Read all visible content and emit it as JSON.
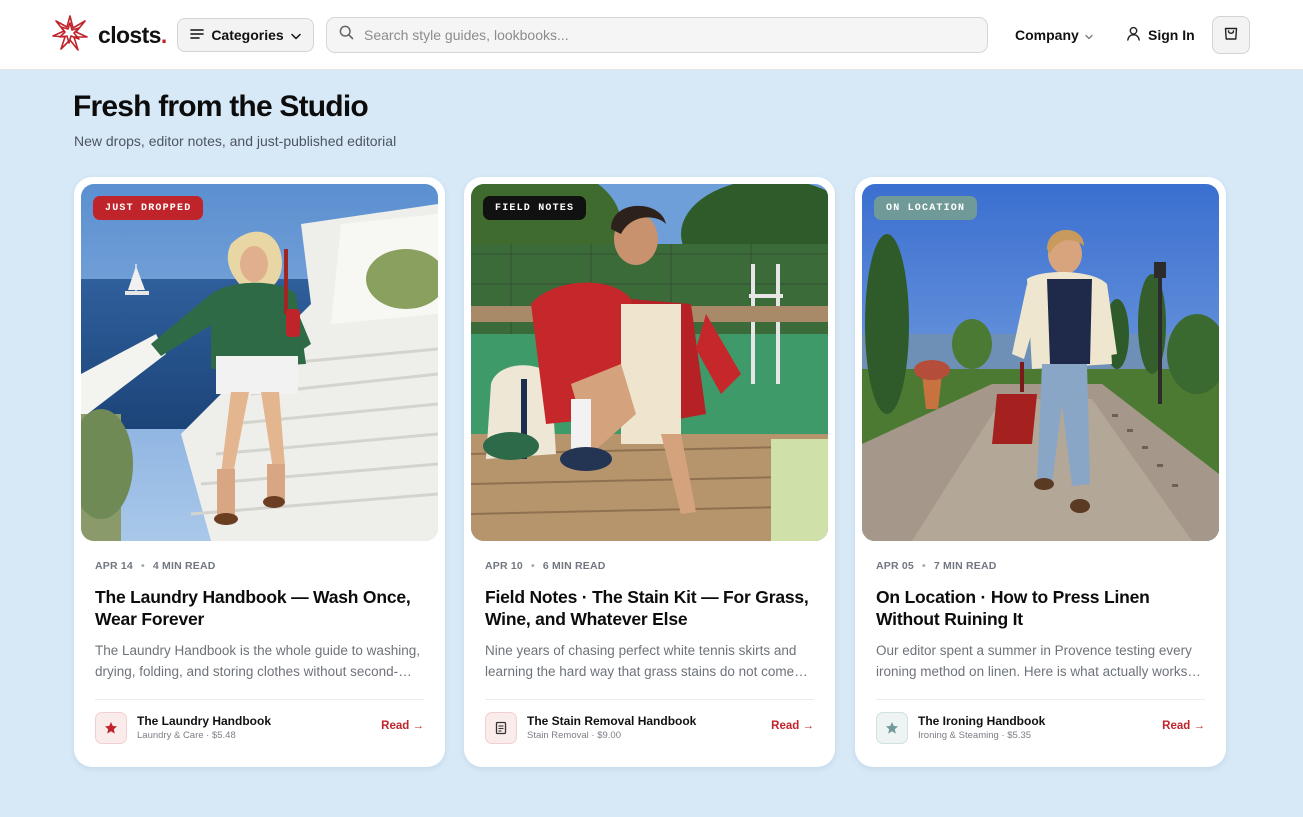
{
  "brand": {
    "name": "closts",
    "dot": ".",
    "accent_color": "#c0242b"
  },
  "header": {
    "categories_label": "Categories",
    "search_placeholder": "Search style guides, lookbooks...",
    "company_label": "Company",
    "signin_label": "Sign In",
    "icons": [
      "logo-burst-icon",
      "menu-lines-icon",
      "chevron-down-icon",
      "search-icon",
      "user-icon",
      "shopping-bag-icon"
    ]
  },
  "section": {
    "title": "Fresh from the Studio",
    "subtitle": "New drops, editor notes, and just-published editorial"
  },
  "cards": [
    {
      "badge": "JUST DROPPED",
      "badge_color": "#c0242b",
      "date": "APR 14",
      "read_time": "4 MIN READ",
      "title": "The Laundry Handbook — Wash Once, Wear Forever",
      "excerpt": "The Laundry Handbook is the whole guide to washing, drying, folding, and storing clothes without second-guessing every label.",
      "product_name": "The Laundry Handbook",
      "product_meta": "Laundry & Care · $5.48",
      "product_icon": "star-icon",
      "product_icon_color": "#c0242b",
      "read_label": "Read →"
    },
    {
      "badge": "FIELD NOTES",
      "badge_color": "#111111",
      "date": "APR 10",
      "read_time": "6 MIN READ",
      "title": "Field Notes · The Stain Kit — For Grass, Wine, and Whatever Else",
      "excerpt": "Nine years of chasing perfect white tennis skirts and learning the hard way that grass stains do not come out on their own.",
      "product_name": "The Stain Removal Handbook",
      "product_meta": "Stain Removal · $9.00",
      "product_icon": "document-icon",
      "product_icon_color": "#333333",
      "read_label": "Read →"
    },
    {
      "badge": "ON LOCATION",
      "badge_color": "#6f9a98",
      "date": "APR 05",
      "read_time": "7 MIN READ",
      "title": "On Location · How to Press Linen Without Ruining It",
      "excerpt": "Our editor spent a summer in Provence testing every ironing method on linen. Here is what actually works and what does not.",
      "product_name": "The Ironing Handbook",
      "product_meta": "Ironing & Steaming · $5.35",
      "product_icon": "star-icon",
      "product_icon_color": "#6f9a98",
      "read_label": "Read →"
    }
  ]
}
